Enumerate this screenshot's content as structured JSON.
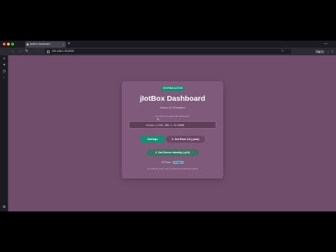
{
  "browser": {
    "tab_title": "jiotBox Dashboard",
    "url": "192.168.1.23:8000",
    "new_tab": "+",
    "back": "←",
    "forward": "→",
    "reload": "↻",
    "minimize": "—",
    "signin": "Sign in"
  },
  "page": {
    "status_badge": "SYSTEM ACTIVE",
    "title": "jIotBox Dashboard",
    "subtitle": "Secure IoT Ecosystem",
    "hint": "Connect to console with iotbox client",
    "command": "https://192.168.1.23:8000",
    "buttons": {
      "settings": "Settings",
      "root_ca": "1. Get Root CA (.pem)",
      "identity": "2. Get Device Identity (.p12)"
    },
    "links": {
      "docs": "API Docs",
      "sep": "·",
      "swagger": "Swagger"
    },
    "footer": "Device Identity: Secure TLS communication and API access enabled"
  },
  "colors": {
    "page_bg": "#714d6c",
    "card_bg": "#805a7b",
    "accent_green": "#148f73",
    "browser_chrome": "#1c1b22"
  }
}
